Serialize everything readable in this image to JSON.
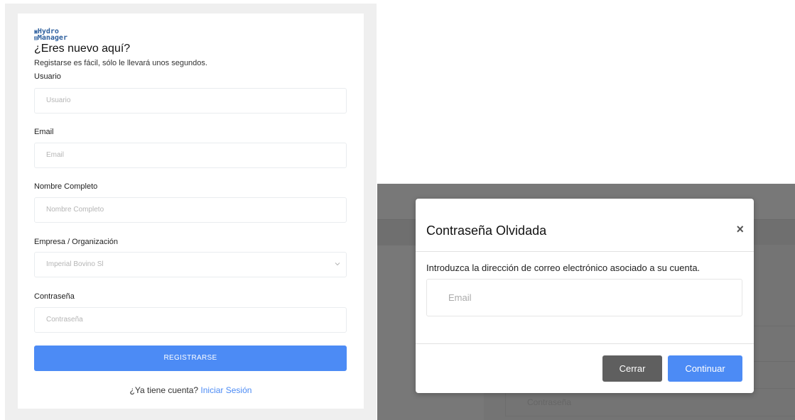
{
  "brand": {
    "line1": "Hydro",
    "line2": "Manager",
    "color": "#2d5f9e"
  },
  "register": {
    "title": "¿Eres nuevo aquí?",
    "subtitle": "Registarse es fácil, sólo le llevará unos segundos.",
    "fields": {
      "usuario": {
        "label": "Usuario",
        "placeholder": "Usuario"
      },
      "email": {
        "label": "Email",
        "placeholder": "Email"
      },
      "nombre": {
        "label": "Nombre Completo",
        "placeholder": "Nombre Completo"
      },
      "empresa": {
        "label": "Empresa / Organización",
        "value": "Imperial Bovino Sl"
      },
      "password": {
        "label": "Contraseña",
        "placeholder": "Contraseña"
      }
    },
    "submit_label": "REGISTRARSE",
    "login_prompt": "¿Ya tiene cuenta?",
    "login_link": "Iniciar Sesión",
    "accent_color": "#4c8bf5"
  },
  "forgot_modal": {
    "title": "Contraseña Olvidada",
    "close_symbol": "×",
    "instructions": "Introduzca la dirección de correo electrónico asociado a su cuenta.",
    "email_placeholder": "Email",
    "close_label": "Cerrar",
    "continue_label": "Continuar",
    "background_field_placeholder": "Contraseña"
  }
}
